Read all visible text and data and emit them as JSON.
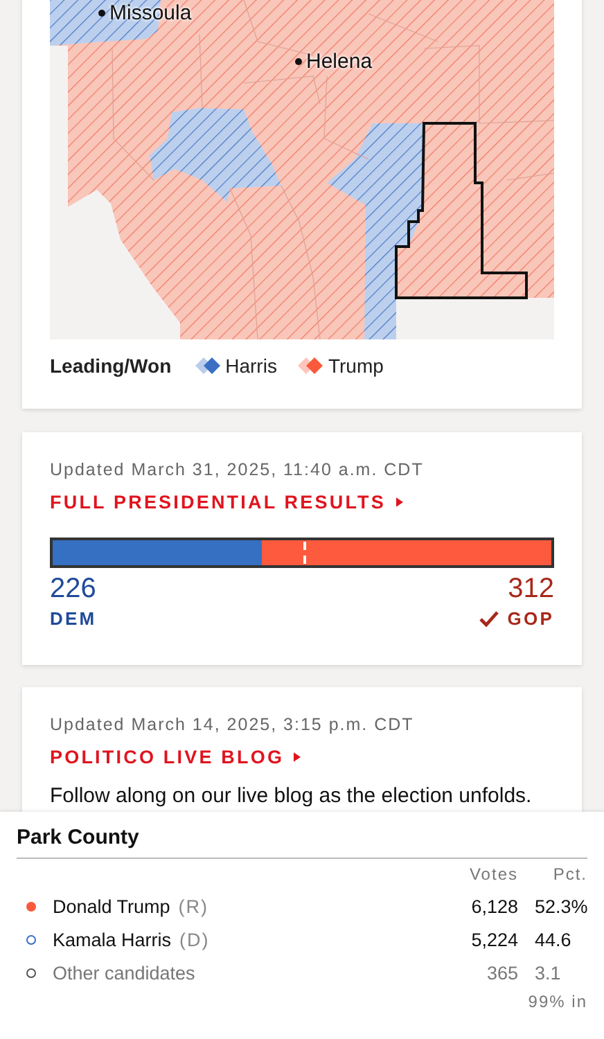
{
  "map": {
    "cities": [
      {
        "name": "Missoula"
      },
      {
        "name": "Helena"
      }
    ],
    "legend": {
      "title": "Leading/Won",
      "items": [
        {
          "label": "Harris",
          "color": "#3a6fc4"
        },
        {
          "label": "Trump",
          "color": "#fa5a3c"
        }
      ]
    }
  },
  "results": {
    "updated": "Updated March 31, 2025, 11:40 a.m. CDT",
    "link": "FULL PRESIDENTIAL RESULTS",
    "dem": {
      "count": "226",
      "party": "DEM",
      "won": false
    },
    "gop": {
      "count": "312",
      "party": "GOP",
      "won": true
    },
    "level": 0.42
  },
  "blog": {
    "updated": "Updated March 14, 2025, 3:15 p.m. CDT",
    "link": "POLITICO LIVE BLOG",
    "text": "Follow along on our live blog as the election unfolds."
  },
  "county": {
    "title": "Park County",
    "columns": [
      "Votes",
      "Pct."
    ],
    "rows": [
      {
        "name": "Donald Trump",
        "party": "(R)",
        "votes": "6,128",
        "pct": "52.3%",
        "color": "#fa5a3c",
        "leading": true,
        "muted": false
      },
      {
        "name": "Kamala Harris",
        "party": "(D)",
        "votes": "5,224",
        "pct": "44.6",
        "color": "#3a6fc4",
        "leading": false,
        "muted": false
      },
      {
        "name": "Other candidates",
        "votes": "365",
        "pct": "3.1",
        "color": "#555555",
        "leading": false,
        "muted": true
      }
    ],
    "reporting": "99% in"
  }
}
